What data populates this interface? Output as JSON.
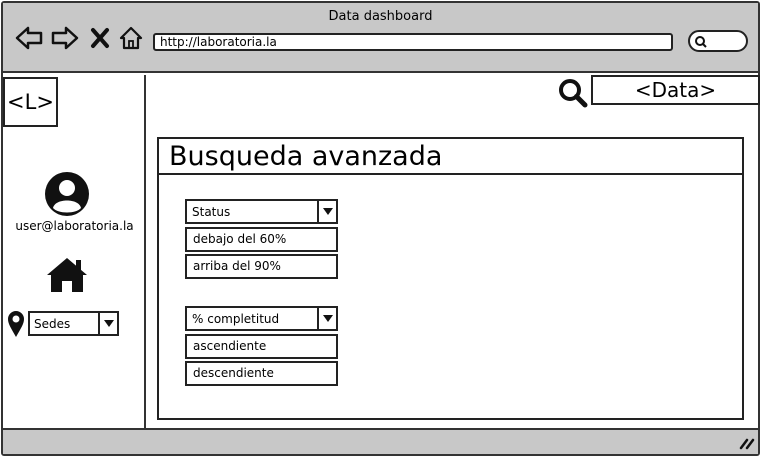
{
  "window": {
    "title": "Data dashboard",
    "url": "http://laboratoria.la"
  },
  "sidebar": {
    "logo": "<L>",
    "user_email": "user@laboratoria.la",
    "sedes_select": "Sedes"
  },
  "header": {
    "data_label": "<Data>"
  },
  "panel": {
    "title": "Busqueda avanzada",
    "status_filter": {
      "selected": "Status",
      "options": [
        "debajo del 60%",
        "arriba del 90%"
      ]
    },
    "completion_filter": {
      "selected": "% completitud",
      "options": [
        "ascendiente",
        "descendiente"
      ]
    }
  }
}
